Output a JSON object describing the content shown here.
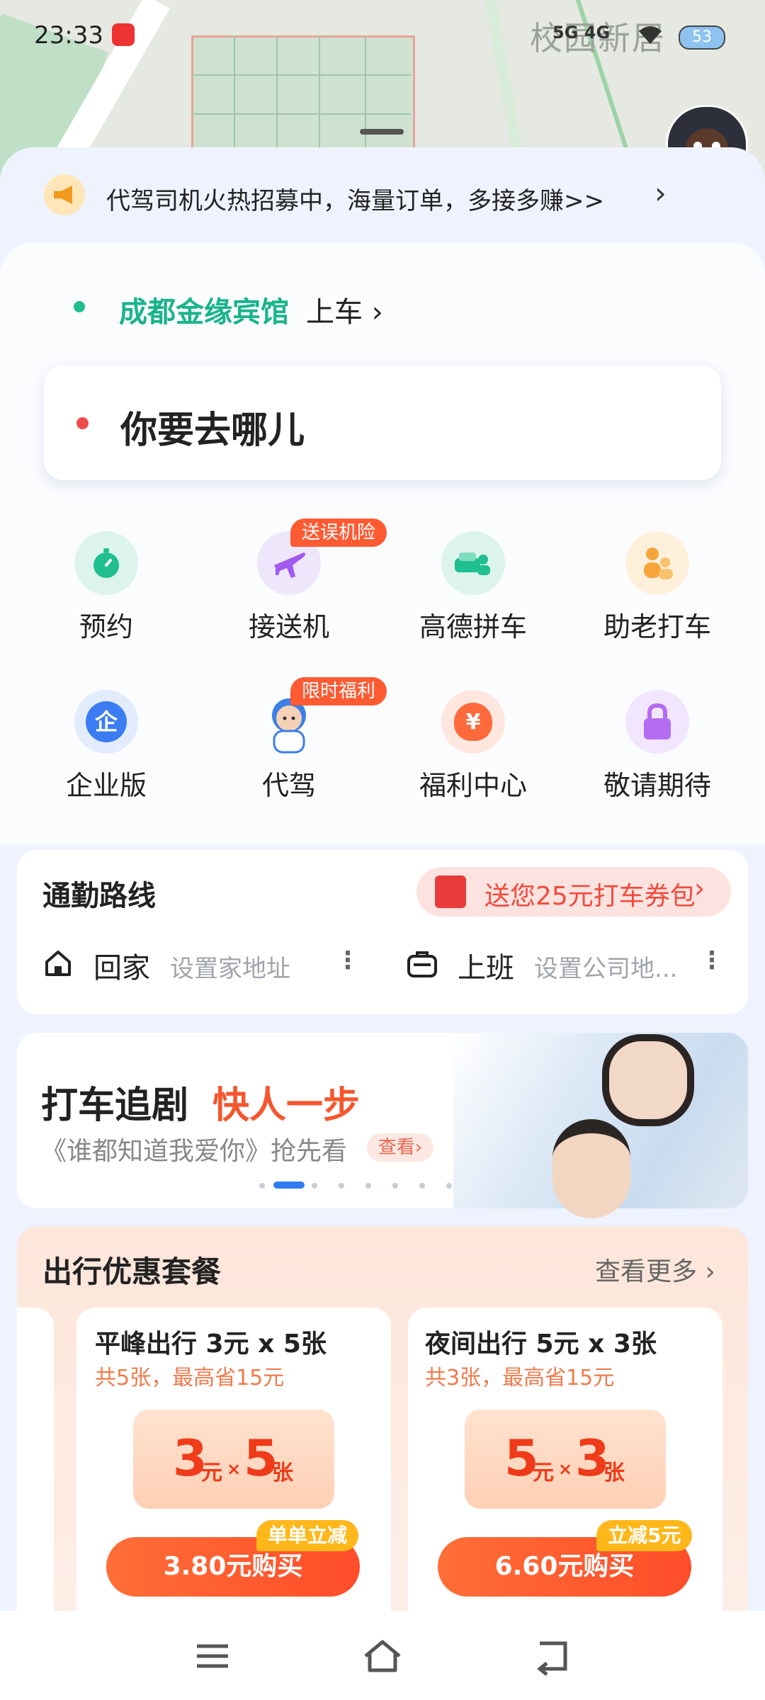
{
  "status_bar": {
    "time": "23:33",
    "network": "5G 4G",
    "battery": "53"
  },
  "map": {
    "place_label": "校园新居"
  },
  "notice": {
    "text": "代驾司机火热招募中，海量订单，多接多赚>>",
    "arrow": "›"
  },
  "pickup": {
    "name": "成都金缘宾馆",
    "suffix": "上车 ›"
  },
  "destination": {
    "placeholder": "你要去哪儿"
  },
  "services": [
    {
      "label": "预约",
      "tag": ""
    },
    {
      "label": "接送机",
      "tag": "送误机险"
    },
    {
      "label": "高德拼车",
      "tag": ""
    },
    {
      "label": "助老打车",
      "tag": ""
    },
    {
      "label": "企业版",
      "tag": ""
    },
    {
      "label": "代驾",
      "tag": "限时福利"
    },
    {
      "label": "福利中心",
      "tag": ""
    },
    {
      "label": "敬请期待",
      "tag": ""
    }
  ],
  "icons": {
    "enterprise_glyph": "企",
    "welfare_glyph": "¥"
  },
  "commute": {
    "title": "通勤路线",
    "promo": "送您25元打车券包",
    "promo_arrow": "›",
    "home": {
      "label": "回家",
      "sub": "设置家地址"
    },
    "work": {
      "label": "上班",
      "sub": "设置公司地..."
    },
    "more": "⋮"
  },
  "promo_banner": {
    "title": "打车追剧",
    "accent": "快人一步",
    "subtitle": "《谁都知道我爱你》抢先看",
    "button": "查看›"
  },
  "packages": {
    "title": "出行优惠套餐",
    "more": "查看更多 ›",
    "items": [
      {
        "title": "平峰出行 3元 x 5张",
        "sub": "共5张，最高省15元",
        "amount": "3",
        "unit": "元",
        "times": "×",
        "count": "5",
        "count_unit": "张",
        "buy": "3.80元购买",
        "tag": "单单立减"
      },
      {
        "title": "夜间出行 5元 x 3张",
        "sub": "共3张，最高省15元",
        "amount": "5",
        "unit": "元",
        "times": "×",
        "count": "3",
        "count_unit": "张",
        "buy": "6.60元购买",
        "tag": "立减5元"
      }
    ]
  },
  "colors": {
    "accent_green": "#18b48c",
    "accent_orange": "#ff5b33",
    "dest_red": "#ef4a4a"
  }
}
